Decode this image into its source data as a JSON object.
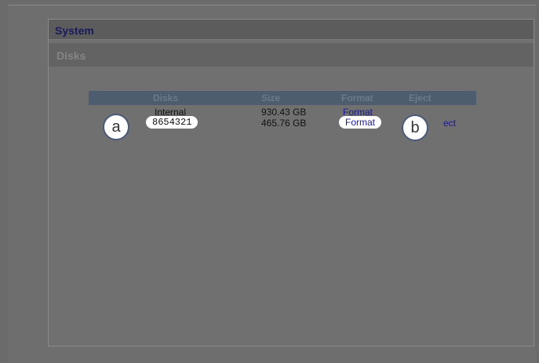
{
  "system": {
    "title": "System"
  },
  "disks_section": {
    "title": "Disks"
  },
  "table": {
    "headers": {
      "name": "Disks",
      "size": "Size",
      "format": "Format",
      "eject": "Eject"
    },
    "rows": [
      {
        "name": "Internal",
        "size": "930.43 GB",
        "format": "Format",
        "eject": ""
      },
      {
        "name": "8654321",
        "size": "465.76 GB",
        "format": "Format",
        "eject": "ect"
      }
    ]
  },
  "callouts": {
    "a": "a",
    "b": "b"
  }
}
